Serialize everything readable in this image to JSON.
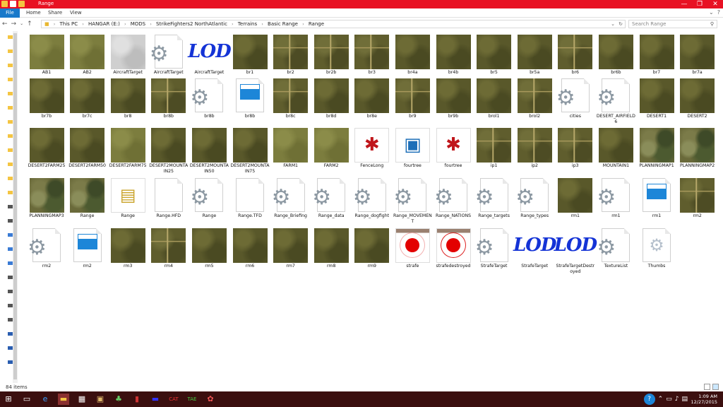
{
  "window": {
    "title": "Range",
    "min": "—",
    "max": "❐",
    "close": "✕"
  },
  "ribbon": {
    "file": "File",
    "tabs": [
      "Home",
      "Share",
      "View"
    ],
    "collapse": "⌄",
    "help": "?"
  },
  "address": {
    "crumbs": [
      "This PC",
      "HANGAR (E:)",
      "MODS",
      "StrikeFighters2 NorthAtlantic",
      "Terrains",
      "Basic Range",
      "Range"
    ],
    "search_placeholder": "Search Range"
  },
  "items": [
    {
      "label": "AB1",
      "kind": "tex",
      "tex": "field"
    },
    {
      "label": "AB2",
      "kind": "tex",
      "tex": "field"
    },
    {
      "label": "AircraftTarget",
      "kind": "tex",
      "tex": "gray"
    },
    {
      "label": "AircraftTarget",
      "kind": "gear"
    },
    {
      "label": "AircraftTarget",
      "kind": "lod"
    },
    {
      "label": "br1",
      "kind": "tex",
      "tex": "veg"
    },
    {
      "label": "br2",
      "kind": "tex",
      "tex": "vegline"
    },
    {
      "label": "br2b",
      "kind": "tex",
      "tex": "vegline"
    },
    {
      "label": "br3",
      "kind": "tex",
      "tex": "vegline"
    },
    {
      "label": "br4a",
      "kind": "tex",
      "tex": "veg"
    },
    {
      "label": "br4b",
      "kind": "tex",
      "tex": "veg"
    },
    {
      "label": "br5",
      "kind": "tex",
      "tex": "veg"
    },
    {
      "label": "br5a",
      "kind": "tex",
      "tex": "veg"
    },
    {
      "label": "br6",
      "kind": "tex",
      "tex": "vegline"
    },
    {
      "label": "br6b",
      "kind": "tex",
      "tex": "veg"
    },
    {
      "label": "br7",
      "kind": "tex",
      "tex": "veg"
    },
    {
      "label": "br7a",
      "kind": "tex",
      "tex": "veg"
    },
    {
      "label": "br7b",
      "kind": "tex",
      "tex": "veg"
    },
    {
      "label": "br7c",
      "kind": "tex",
      "tex": "veg"
    },
    {
      "label": "br8",
      "kind": "tex",
      "tex": "veg"
    },
    {
      "label": "br8b",
      "kind": "tex",
      "tex": "vegline"
    },
    {
      "label": "br8b",
      "kind": "gear"
    },
    {
      "label": "br8b",
      "kind": "clap"
    },
    {
      "label": "br8c",
      "kind": "tex",
      "tex": "vegline"
    },
    {
      "label": "br8d",
      "kind": "tex",
      "tex": "veg"
    },
    {
      "label": "br8e",
      "kind": "tex",
      "tex": "veg"
    },
    {
      "label": "br9",
      "kind": "tex",
      "tex": "vegline"
    },
    {
      "label": "br9b",
      "kind": "tex",
      "tex": "veg"
    },
    {
      "label": "brol1",
      "kind": "tex",
      "tex": "veg"
    },
    {
      "label": "brol2",
      "kind": "tex",
      "tex": "vegline"
    },
    {
      "label": "cities",
      "kind": "gear"
    },
    {
      "label": "DESERT_AIRFIELD6",
      "kind": "gear"
    },
    {
      "label": "DESERT1",
      "kind": "tex",
      "tex": "veg"
    },
    {
      "label": "DESERT2",
      "kind": "tex",
      "tex": "veg"
    },
    {
      "label": "DESERT2FARM25",
      "kind": "tex",
      "tex": "veg"
    },
    {
      "label": "DESERT2FARM50",
      "kind": "tex",
      "tex": "veg"
    },
    {
      "label": "DESERT2FARM75",
      "kind": "tex",
      "tex": "field"
    },
    {
      "label": "DESERT2MOUNTAIN25",
      "kind": "tex",
      "tex": "veg"
    },
    {
      "label": "DESERT2MOUNTAIN50",
      "kind": "tex",
      "tex": "veg"
    },
    {
      "label": "DESERT2MOUNTAIN75",
      "kind": "tex",
      "tex": "veg"
    },
    {
      "label": "FARM1",
      "kind": "tex",
      "tex": "field"
    },
    {
      "label": "FARM2",
      "kind": "tex",
      "tex": "field"
    },
    {
      "label": "FenceLong",
      "kind": "app"
    },
    {
      "label": "fourtree",
      "kind": "app2"
    },
    {
      "label": "fourtree",
      "kind": "app"
    },
    {
      "label": "ip1",
      "kind": "tex",
      "tex": "vegline"
    },
    {
      "label": "ip2",
      "kind": "tex",
      "tex": "vegline"
    },
    {
      "label": "ip3",
      "kind": "tex",
      "tex": "vegline"
    },
    {
      "label": "MOUNTAIN1",
      "kind": "tex",
      "tex": "veg"
    },
    {
      "label": "PLANNINGMAP1",
      "kind": "tex",
      "tex": "camo"
    },
    {
      "label": "PLANNINGMAP2",
      "kind": "tex",
      "tex": "camo"
    },
    {
      "label": "PLANNINGMAP3",
      "kind": "tex",
      "tex": "camo"
    },
    {
      "label": "Range",
      "kind": "tex",
      "tex": "camo"
    },
    {
      "label": "Range",
      "kind": "ini"
    },
    {
      "label": "Range.HFD",
      "kind": "blank"
    },
    {
      "label": "Range",
      "kind": "gear"
    },
    {
      "label": "Range.TFD",
      "kind": "blank"
    },
    {
      "label": "Range_Briefing",
      "kind": "gear"
    },
    {
      "label": "Range_data",
      "kind": "gear"
    },
    {
      "label": "Range_dogfight",
      "kind": "gear"
    },
    {
      "label": "Range_MOVEMENT",
      "kind": "gear"
    },
    {
      "label": "Range_NATIONS",
      "kind": "gear"
    },
    {
      "label": "Range_targets",
      "kind": "gear"
    },
    {
      "label": "Range_types",
      "kind": "gear"
    },
    {
      "label": "rm1",
      "kind": "tex",
      "tex": "veg"
    },
    {
      "label": "rm1",
      "kind": "gear"
    },
    {
      "label": "rm1",
      "kind": "clap"
    },
    {
      "label": "rm2",
      "kind": "tex",
      "tex": "vegline"
    },
    {
      "label": "rm2",
      "kind": "gear"
    },
    {
      "label": "rm2",
      "kind": "clap"
    },
    {
      "label": "rm3",
      "kind": "tex",
      "tex": "veg"
    },
    {
      "label": "rm4",
      "kind": "tex",
      "tex": "vegline"
    },
    {
      "label": "rm5",
      "kind": "tex",
      "tex": "veg"
    },
    {
      "label": "rm6",
      "kind": "tex",
      "tex": "veg"
    },
    {
      "label": "rm7",
      "kind": "tex",
      "tex": "veg"
    },
    {
      "label": "rm8",
      "kind": "tex",
      "tex": "veg"
    },
    {
      "label": "rm9",
      "kind": "tex",
      "tex": "veg"
    },
    {
      "label": "strafe",
      "kind": "target"
    },
    {
      "label": "strafedestroyed",
      "kind": "target2"
    },
    {
      "label": "StrafeTarget",
      "kind": "gear"
    },
    {
      "label": "StrafeTarget",
      "kind": "lod"
    },
    {
      "label": "StrafeTargetDestroyed",
      "kind": "lod"
    },
    {
      "label": "TextureList",
      "kind": "gear"
    },
    {
      "label": "Thumbs",
      "kind": "thumbs"
    }
  ],
  "status": {
    "count": "84 items"
  },
  "taskbar": {
    "time": "1:09 AM",
    "date": "12/27/2015"
  }
}
